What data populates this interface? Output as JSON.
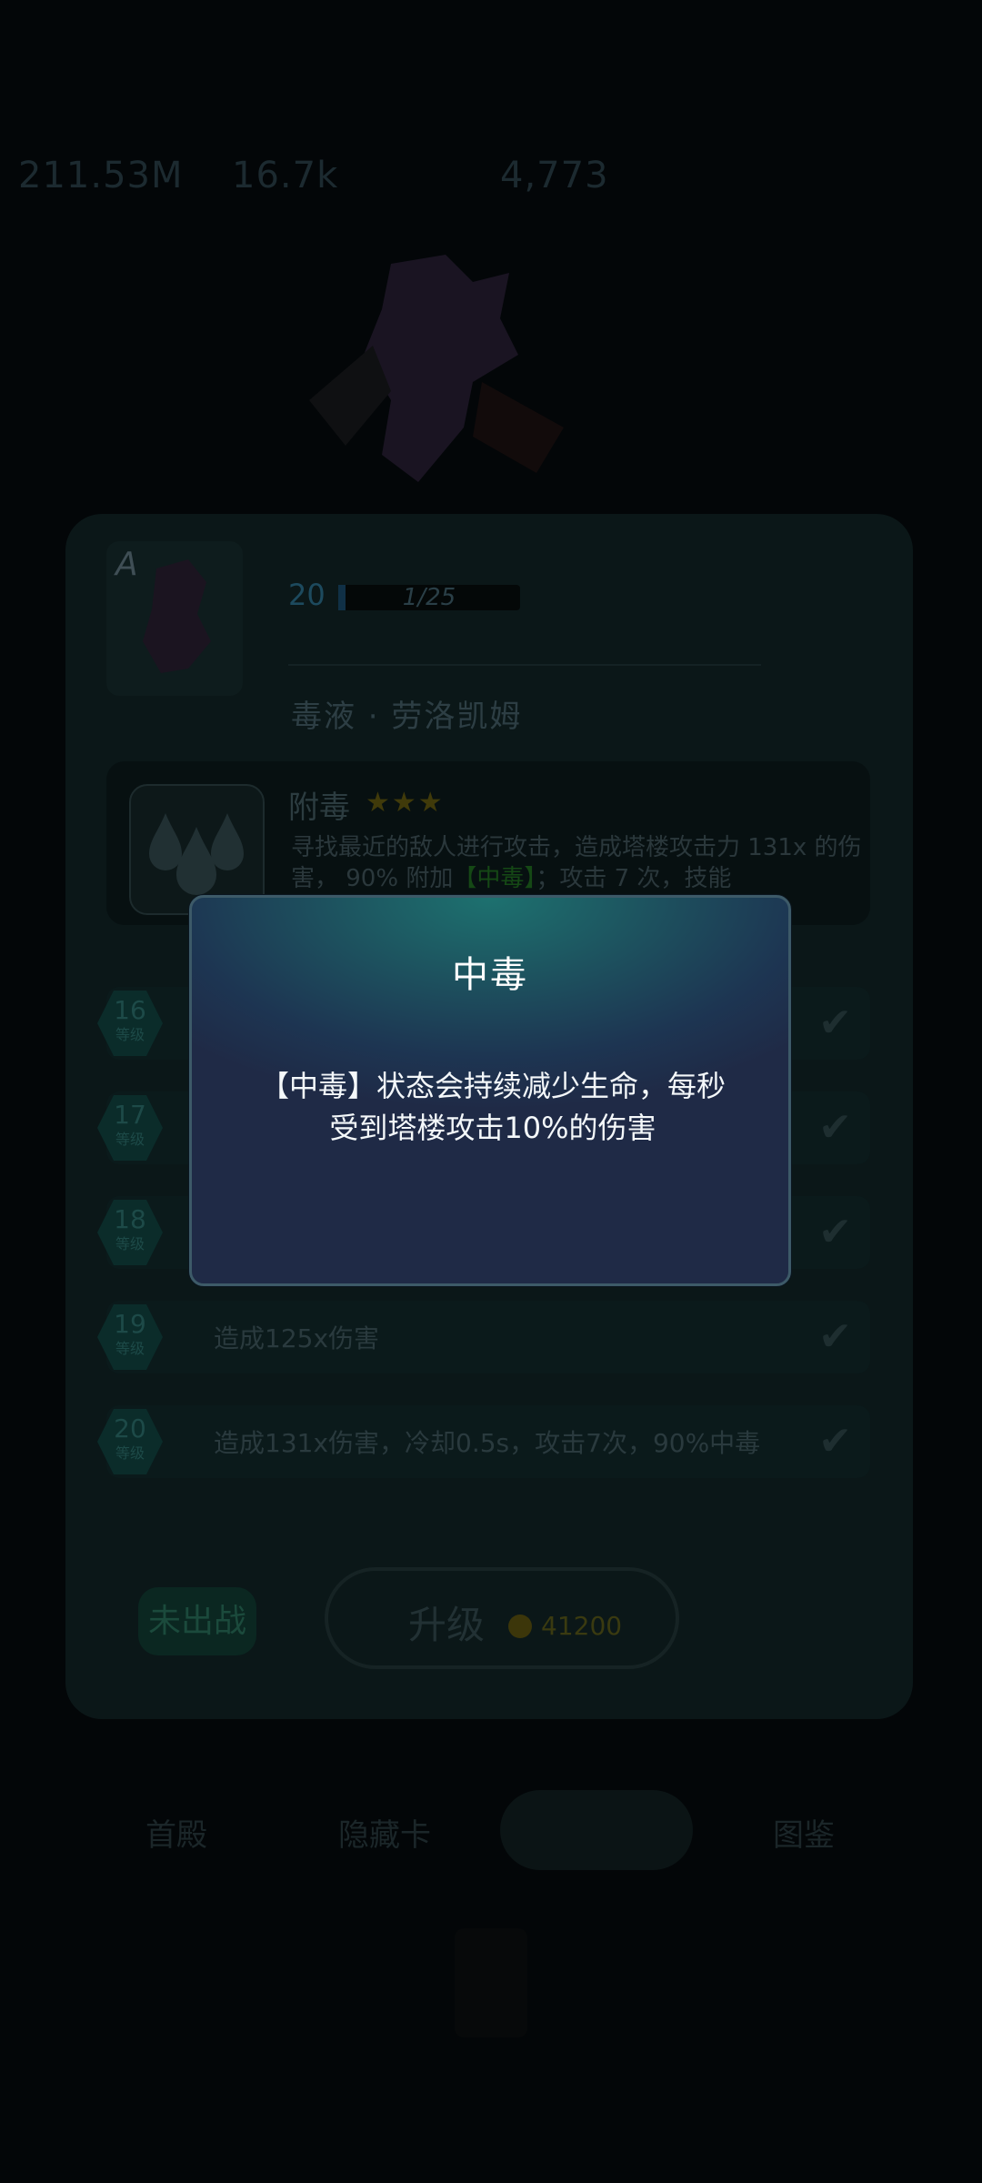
{
  "resources": {
    "r1": "211.53M",
    "r2": "16.7k",
    "r3": "4,773"
  },
  "hero": {
    "rank": "A",
    "level": "20",
    "xp": "1/25",
    "name": "毒液 · 劳洛凯姆"
  },
  "skill": {
    "name": "附毒",
    "stars": "★★★",
    "star_count": 3,
    "desc_prefix": "寻找最近的敌人进行攻击，造成塔楼攻击力 131x 的伤害， 90% 附加",
    "desc_poison": "【中毒】",
    "desc_suffix": "；攻击 7 次，技能"
  },
  "levels": [
    {
      "num": "16",
      "tag": "等级",
      "text": ""
    },
    {
      "num": "17",
      "tag": "等级",
      "text": ""
    },
    {
      "num": "18",
      "tag": "等级",
      "text": ""
    },
    {
      "num": "19",
      "tag": "等级",
      "text": "造成125x伤害"
    },
    {
      "num": "20",
      "tag": "等级",
      "text": "造成131x伤害，冷却0.5s，攻击7次，90%中毒"
    }
  ],
  "actions": {
    "deploy": "未出战",
    "upgrade": "升级",
    "upgrade_cost": "41200"
  },
  "nav": {
    "item1": "首殿",
    "item2": "隐藏卡",
    "item3": "",
    "item4": "图鉴"
  },
  "modal": {
    "title": "中毒",
    "body": "【中毒】状态会持续减少生命，每秒受到塔楼攻击10%的伤害"
  },
  "colors": {
    "modal_top": "#1d716f",
    "modal_bottom": "#1f2a46",
    "poison_green": "#2ecc40",
    "star_gold": "#d9c21f"
  }
}
